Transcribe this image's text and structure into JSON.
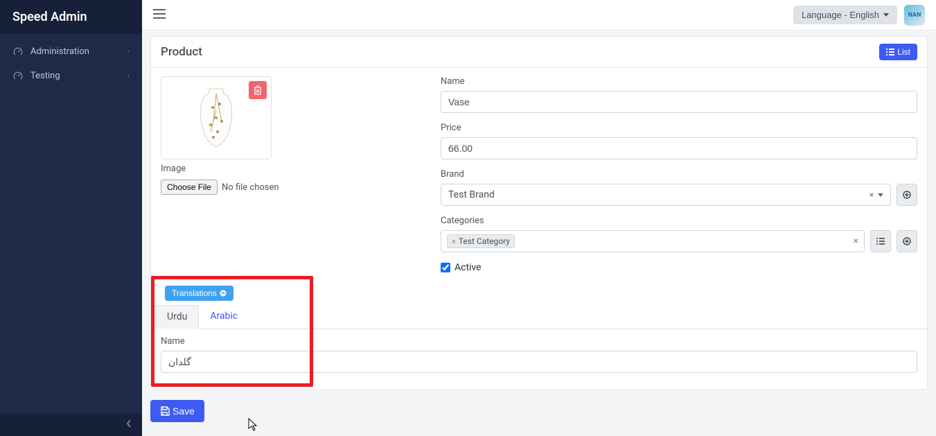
{
  "brand": "Speed Admin",
  "sidebar": {
    "items": [
      {
        "label": "Administration",
        "icon": "speedometer"
      },
      {
        "label": "Testing",
        "icon": "speedometer"
      }
    ]
  },
  "topbar": {
    "language_label": "Language - English"
  },
  "page": {
    "title": "Product",
    "list_btn": "List"
  },
  "form": {
    "image_label": "Image",
    "choose_file": "Choose File",
    "no_file": "No file chosen",
    "name_label": "Name",
    "name_value": "Vase",
    "price_label": "Price",
    "price_value": "66.00",
    "brand_label": "Brand",
    "brand_value": "Test Brand",
    "categories_label": "Categories",
    "categories_value": "Test Category",
    "active_label": "Active",
    "active_checked": true
  },
  "translations": {
    "btn_label": "Translations",
    "tabs": [
      "Urdu",
      "Arabic"
    ],
    "active_tab": "Urdu",
    "name_label": "Name",
    "name_value": "گلدان"
  },
  "actions": {
    "save": "Save"
  }
}
